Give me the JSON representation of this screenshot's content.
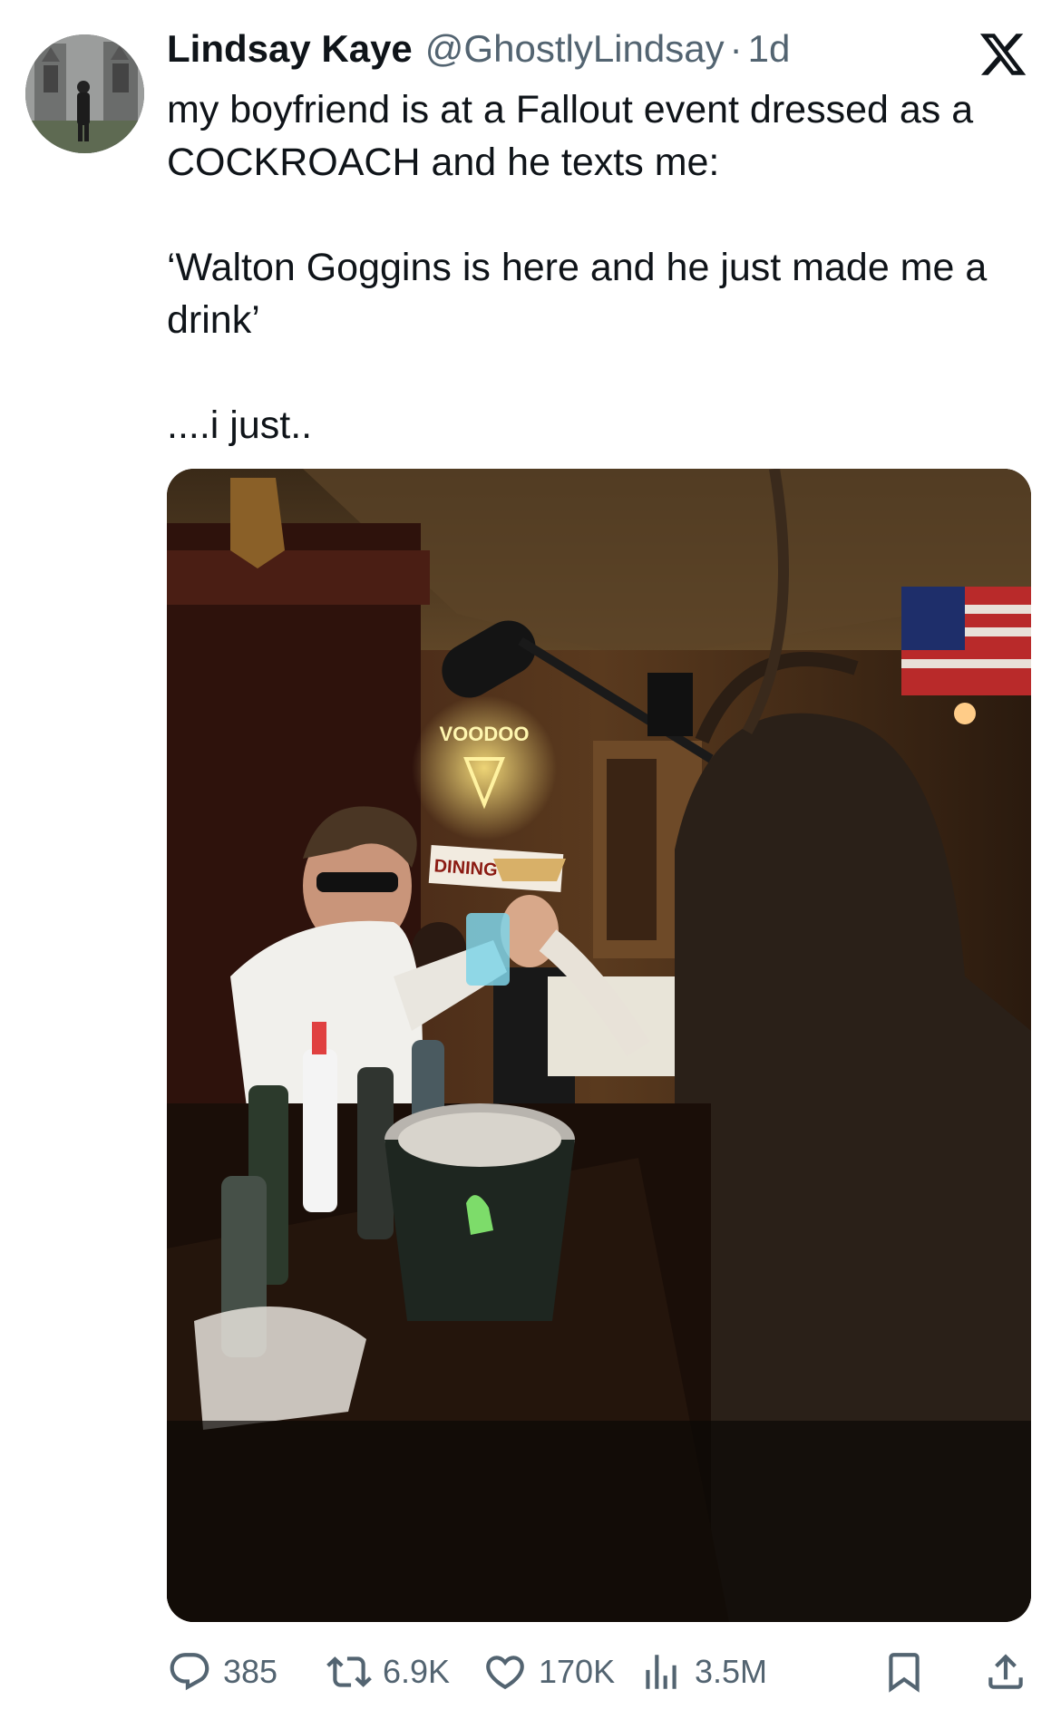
{
  "tweet": {
    "author": {
      "name": "Lindsay Kaye",
      "handle": "@GhostlyLindsay",
      "separator": "·",
      "time": "1d",
      "avatar_icon": "avatar-photo"
    },
    "platform_logo_icon": "x-logo-icon",
    "text_lines": [
      "my boyfriend is at a Fallout event dressed as a COCKROACH and he texts me:",
      "",
      "‘Walton Goggins is here and he just made me a drink’",
      "",
      "....i just.."
    ],
    "media": {
      "sign_text": "DINING ROOM",
      "neon_text": "VOODOO"
    },
    "actions": {
      "reply": {
        "icon": "reply-icon",
        "count": "385"
      },
      "retweet": {
        "icon": "retweet-icon",
        "count": "6.9K"
      },
      "like": {
        "icon": "heart-icon",
        "count": "170K"
      },
      "views": {
        "icon": "views-icon",
        "count": "3.5M"
      },
      "bookmark": {
        "icon": "bookmark-icon"
      },
      "share": {
        "icon": "share-icon"
      }
    },
    "colors": {
      "text_primary": "#0f1419",
      "text_secondary": "#536471"
    }
  }
}
